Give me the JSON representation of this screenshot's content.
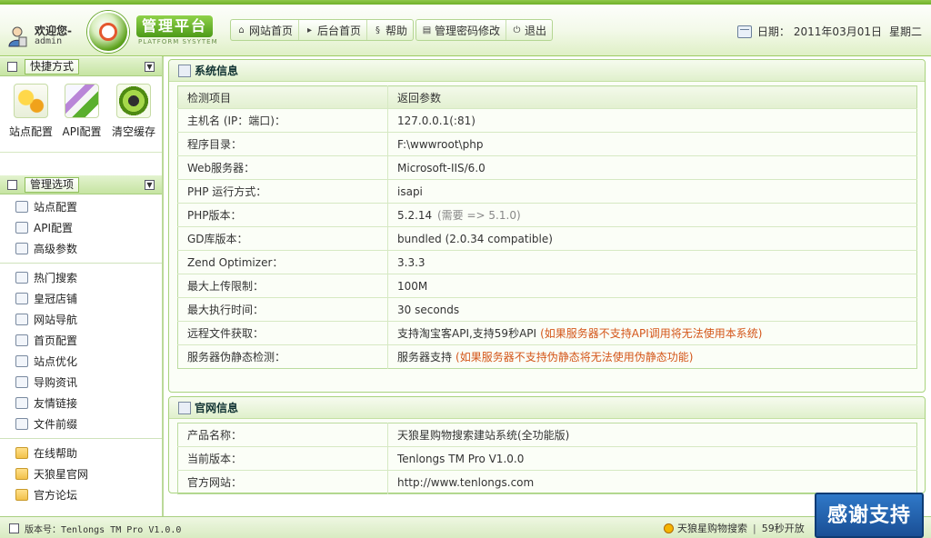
{
  "header": {
    "welcome_text": "欢迎您-",
    "username": "admin",
    "logo_title": "管理平台",
    "logo_subtitle": "PLATFORM SYSYTEM",
    "nav_left": [
      {
        "label": "网站首页",
        "icon": "home-icon"
      },
      {
        "label": "后台首页",
        "icon": "play-icon"
      },
      {
        "label": "帮助",
        "icon": "help-icon"
      }
    ],
    "nav_right": [
      {
        "label": "管理密码修改",
        "icon": "password-icon"
      },
      {
        "label": "退出",
        "icon": "power-icon"
      }
    ],
    "date_label": "日期：",
    "date_value": "2011年03月01日",
    "weekday": "星期二"
  },
  "sidebar": {
    "shortcuts_title": "快捷方式",
    "shortcuts": [
      {
        "label": "站点配置",
        "icon": "gears-icon"
      },
      {
        "label": "API配置",
        "icon": "api-icon"
      },
      {
        "label": "清空缓存",
        "icon": "clear-cache-icon"
      }
    ],
    "manage_title": "管理选项",
    "group1": [
      {
        "label": "站点配置"
      },
      {
        "label": "API配置"
      },
      {
        "label": "高级参数"
      }
    ],
    "group2": [
      {
        "label": "热门搜索"
      },
      {
        "label": "皇冠店铺"
      },
      {
        "label": "网站导航"
      },
      {
        "label": "首页配置"
      },
      {
        "label": "站点优化"
      },
      {
        "label": "导购资讯"
      },
      {
        "label": "友情链接"
      },
      {
        "label": "文件前缀"
      }
    ],
    "group3": [
      {
        "label": "在线帮助"
      },
      {
        "label": "天狼星官网"
      },
      {
        "label": "官方论坛"
      }
    ]
  },
  "system_info": {
    "title": "系统信息",
    "col1": "检测项目",
    "col2": "返回参数",
    "rows": [
      {
        "k": "主机名 (IP：端口)：",
        "v": "127.0.0.1(:81)"
      },
      {
        "k": "程序目录：",
        "v": "F:\\wwwroot\\php"
      },
      {
        "k": "Web服务器：",
        "v": "Microsoft-IIS/6.0"
      },
      {
        "k": "PHP 运行方式：",
        "v": "isapi"
      },
      {
        "k": "PHP版本：",
        "v": "5.2.14",
        "extra": "(需要 => 5.1.0)"
      },
      {
        "k": "GD库版本：",
        "v": "bundled (2.0.34 compatible)"
      },
      {
        "k": "Zend Optimizer：",
        "v": "3.3.3"
      },
      {
        "k": "最大上传限制：",
        "v": "100M"
      },
      {
        "k": "最大执行时间：",
        "v": "30 seconds"
      },
      {
        "k": "远程文件获取：",
        "v": "支持淘宝客API,支持59秒API",
        "note": "(如果服务器不支持API调用将无法使用本系统)"
      },
      {
        "k": "服务器伪静态检测：",
        "v": "服务器支持",
        "note": "(如果服务器不支持伪静态将无法使用伪静态功能)"
      }
    ]
  },
  "official_info": {
    "title": "官网信息",
    "rows": [
      {
        "k": "产品名称：",
        "v": "天狼星购物搜索建站系统(全功能版)"
      },
      {
        "k": "当前版本：",
        "v": "Tenlongs TM Pro V1.0.0"
      },
      {
        "k": "官方网站：",
        "v": "http://www.tenlongs.com"
      }
    ]
  },
  "footer": {
    "version_text": "版本号：Tenlongs TM Pro V1.0.0",
    "brand_text": "天狼星购物搜索",
    "right_text": "59秒开放"
  },
  "thanks_badge": "感谢支持",
  "colors": {
    "brand_green": "#6fb02a",
    "note_orange": "#d4561a",
    "thanks_blue": "#1a4f95"
  }
}
